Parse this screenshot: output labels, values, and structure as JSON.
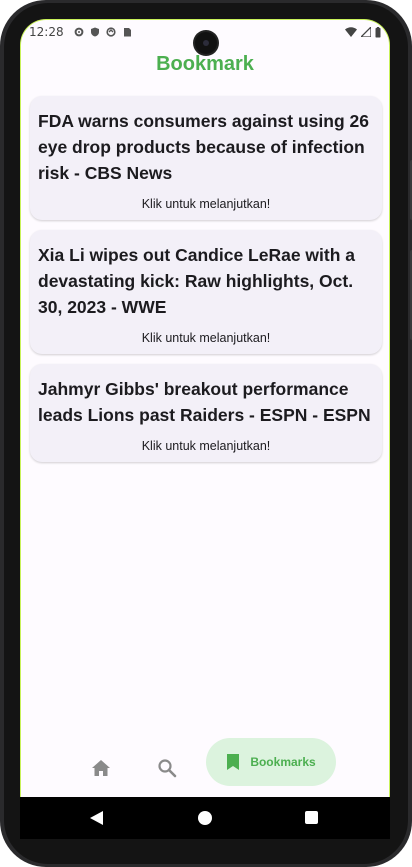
{
  "status_bar": {
    "time": "12:28"
  },
  "header": {
    "title": "Bookmark"
  },
  "bookmarks": [
    {
      "title": "FDA warns consumers against using 26 eye drop products because of infection risk - CBS News",
      "action": "Klik untuk melanjutkan!"
    },
    {
      "title": "Xia Li wipes out Candice LeRae with a devastating kick: Raw highlights, Oct. 30, 2023 - WWE",
      "action": "Klik untuk melanjutkan!"
    },
    {
      "title": "Jahmyr Gibbs' breakout performance leads Lions past Raiders - ESPN - ESPN",
      "action": "Klik untuk melanjutkan!"
    }
  ],
  "bottom_nav": {
    "items": [
      {
        "icon": "home-icon",
        "label": ""
      },
      {
        "icon": "search-icon",
        "label": ""
      },
      {
        "icon": "bookmark-icon",
        "label": "Bookmarks",
        "selected": true
      }
    ]
  },
  "colors": {
    "accent": "#4caf50",
    "selected_pill": "#dcf3de",
    "card_bg": "#f3f0f8",
    "screen_bg": "#fefbff",
    "nav_icon_inactive": "#8a8a8a"
  }
}
